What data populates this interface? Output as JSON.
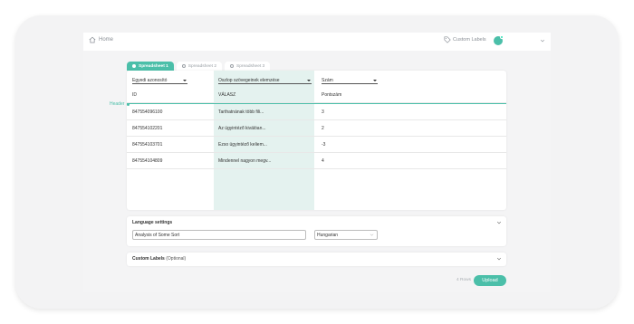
{
  "colors": {
    "accent": "#4bbfa9",
    "highlight_column": "#e4f2ef",
    "frame": "#f3f3f4"
  },
  "topbar": {
    "home_label": "Home",
    "home_icon": "home-icon",
    "custom_labels": "Custom Labels",
    "tag_icon": "tag-icon"
  },
  "tabs": [
    {
      "label": "Spreadsheet 1",
      "active": true
    },
    {
      "label": "Spreadsheet 2",
      "active": false
    },
    {
      "label": "Spreadsheet 3",
      "active": false
    }
  ],
  "sheet": {
    "columns": [
      {
        "type": "Egyedi azonosító",
        "header": "ID"
      },
      {
        "type": "Oszlop szövegeinek elemzése",
        "header": "VÁLASZ"
      },
      {
        "type": "Szám",
        "header": "Pontszám"
      }
    ],
    "header_marker": "Header",
    "rows": [
      [
        "847554096100",
        "Tarthatnának több fili...",
        "3"
      ],
      [
        "847554102201",
        "Az ügyintéző kiválóan...",
        "2"
      ],
      [
        "847554103701",
        "Ezso ügyintéző keliem...",
        "-3"
      ],
      [
        "847554104809",
        "Mindennel nagyon megv...",
        "4"
      ]
    ]
  },
  "language_settings": {
    "title": "Language settings",
    "analysis_name": "Analysis of Some Sort",
    "language": "Hungarian"
  },
  "custom_labels_panel": {
    "title": "Custom Labels",
    "optional": "(Optional)"
  },
  "footer": {
    "rows_count": "4 Rows",
    "upload_label": "Upload"
  }
}
